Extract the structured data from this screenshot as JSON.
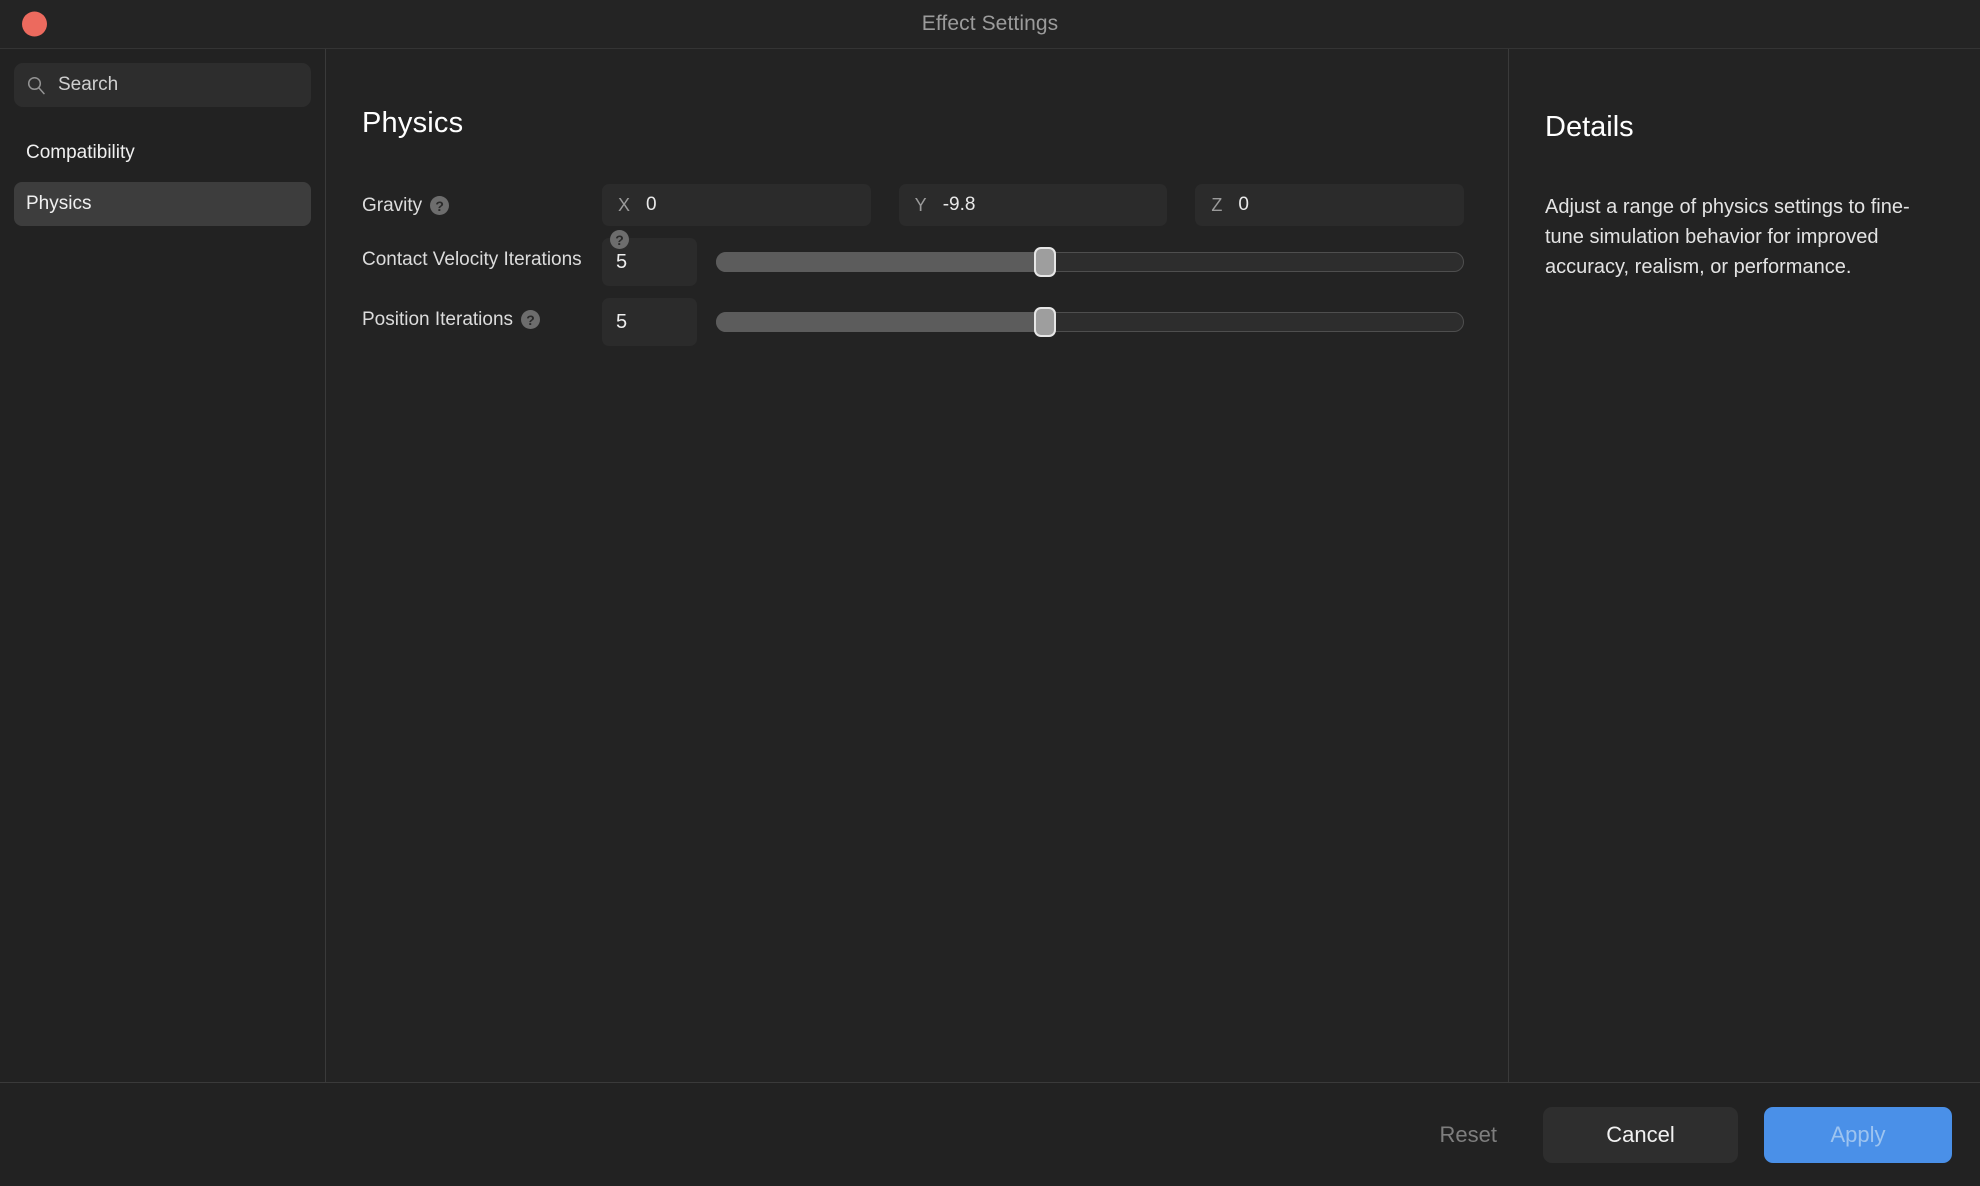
{
  "window": {
    "title": "Effect Settings",
    "close_button_color": "#ec6a5e"
  },
  "sidebar": {
    "search": {
      "placeholder": "Search",
      "value": "",
      "icon": "search-icon"
    },
    "items": [
      {
        "label": "Compatibility",
        "selected": false
      },
      {
        "label": "Physics",
        "selected": true
      }
    ]
  },
  "main": {
    "section_title": "Physics",
    "fields": [
      {
        "label": "Gravity",
        "help_icon": "help-circle-icon",
        "type": "vector3",
        "components": [
          {
            "axis": "X",
            "value": "0"
          },
          {
            "axis": "Y",
            "value": "-9.8"
          },
          {
            "axis": "Z",
            "value": "0"
          }
        ]
      },
      {
        "label": "Contact Velocity Iterations",
        "help_icon": "help-circle-icon",
        "type": "slider",
        "value": "5",
        "slider_percent": 44
      },
      {
        "label": "Position Iterations",
        "help_icon": "help-circle-icon",
        "type": "slider",
        "value": "5",
        "slider_percent": 44
      }
    ]
  },
  "details": {
    "title": "Details",
    "body": "Adjust a range of physics settings to fine-tune simulation behavior for improved accuracy, realism, or performance."
  },
  "footer": {
    "reset_label": "Reset",
    "cancel_label": "Cancel",
    "apply_label": "Apply",
    "apply_color": "#4a90e8"
  }
}
